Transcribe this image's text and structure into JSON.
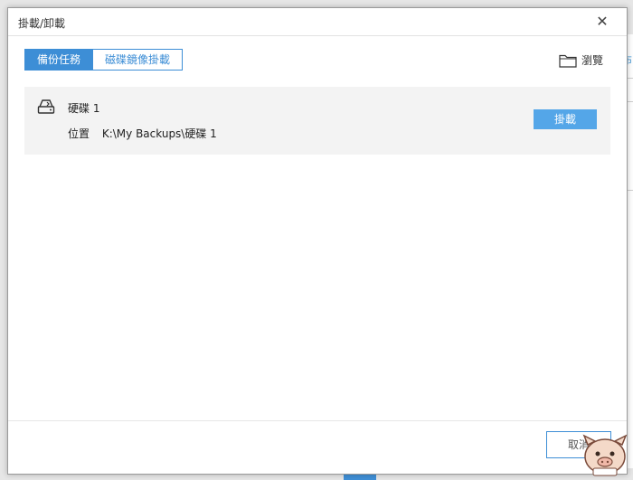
{
  "dialog": {
    "title": "掛載/卸載",
    "close_glyph": "✕"
  },
  "tabs": [
    {
      "label": "備份任務",
      "active": true
    },
    {
      "label": "磁碟鏡像掛載",
      "active": false
    }
  ],
  "browse": {
    "label": "瀏覽",
    "icon": "folder-icon"
  },
  "task": {
    "icon": "hard-disk-icon",
    "name": "硬碟 1",
    "location_label": "位置",
    "location_value": "K:\\My Backups\\硬碟 1",
    "mount_label": "掛載"
  },
  "footer": {
    "cancel_label": "取消"
  },
  "background": {
    "peek_text": "布"
  },
  "colors": {
    "accent": "#3d8ed6",
    "mount_button": "#54a6e8",
    "row_bg": "#f3f3f3"
  }
}
